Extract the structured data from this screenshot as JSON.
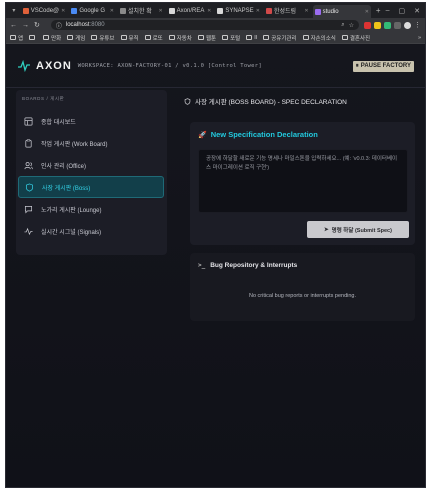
{
  "browser": {
    "tabs": [
      {
        "label": "VSCode@",
        "color": "#e0613a"
      },
      {
        "label": "Google G",
        "color": "#4a8af4"
      },
      {
        "label": "설치한 확",
        "color": "#8a8a8a"
      },
      {
        "label": "Axon/REA",
        "color": "#d8d8d8"
      },
      {
        "label": "SYNAPSE",
        "color": "#d8d8d8"
      },
      {
        "label": "한성드림",
        "color": "#d24a4a"
      },
      {
        "label": "studio",
        "color": "#9b6cf0"
      }
    ],
    "url_host": "localhost",
    "url_port": ":8080",
    "bookmarks": [
      "앱",
      "",
      "만화",
      "게임",
      "유튜브",
      "뮤직",
      "로또",
      "자동차",
      "웹툰",
      "포털",
      "II",
      "공유기관리",
      "자손의소식",
      "결혼사진"
    ],
    "bookmarks_more": "»"
  },
  "header": {
    "brand": "AXON",
    "workspace": "WORKSPACE: AXON-FACTORY-01 / v0.1.0 [Control Tower]",
    "pause_label": "PAUSE FACTORY"
  },
  "sidebar": {
    "title": "BOARDS / 게시판",
    "items": [
      {
        "label": "종합 대시보드",
        "icon": "dashboard-icon"
      },
      {
        "label": "작업 게시판 (Work Board)",
        "icon": "clipboard-icon"
      },
      {
        "label": "인사 관리 (Office)",
        "icon": "users-icon"
      },
      {
        "label": "사장 게시판 (Boss)",
        "icon": "shield-icon"
      },
      {
        "label": "노가리 게시판 (Lounge)",
        "icon": "chat-icon"
      },
      {
        "label": "실시간 시그널 (Signals)",
        "icon": "pulse-icon"
      }
    ]
  },
  "main": {
    "title": "사장 게시판 (BOSS BOARD) - SPEC DECLARATION",
    "spec_heading": "New Specification Declaration",
    "spec_placeholder": "공장에 하달할 새로운 기능 명세나 마일스톤을 입력하세요... (예: 'v0.0.3: 데이터베이스 마이그레이션 로직 구현')",
    "submit_label": "명령 하달 (Submit Spec)",
    "bugs_heading": "Bug Repository & Interrupts",
    "bugs_empty": "No critical bug reports or interrupts pending."
  },
  "colors": {
    "accent": "#22c9de",
    "active_bg": "#123f4a",
    "panel": "#1c1d26"
  }
}
